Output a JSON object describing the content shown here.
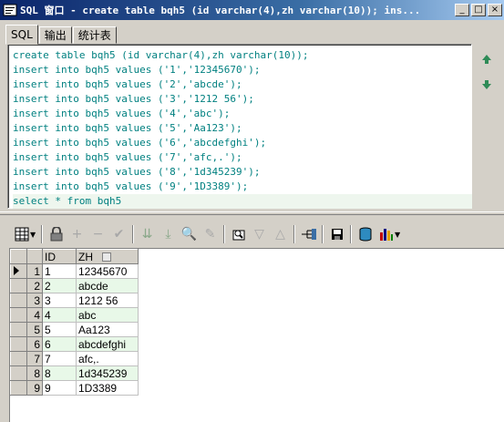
{
  "window": {
    "title": "SQL 窗口 - create table bqh5 (id varchar(4),zh varchar(10)); ins...",
    "buttons": {
      "minimize": "_",
      "maximize": "□",
      "close": "×"
    }
  },
  "tabs": [
    {
      "label": "SQL",
      "active": true
    },
    {
      "label": "输出",
      "active": false
    },
    {
      "label": "统计表",
      "active": false
    }
  ],
  "sql_lines": [
    "create table bqh5 (id varchar(4),zh varchar(10));",
    "insert into bqh5 values ('1','12345670');",
    "insert into bqh5 values ('2','abcde');",
    "insert into bqh5 values ('3','1212 56');",
    "insert into bqh5 values ('4','abc');",
    "insert into bqh5 values ('5','Aa123');",
    "insert into bqh5 values ('6','abcdefghi');",
    "insert into bqh5 values ('7','afc,.');",
    "insert into bqh5 values ('8','1d345239');",
    "insert into bqh5 values ('9','1D3389');",
    "select * from bqh5"
  ],
  "grid": {
    "columns": [
      "ID",
      "ZH"
    ],
    "rows": [
      {
        "num": "1",
        "id": "1",
        "zh": "12345670"
      },
      {
        "num": "2",
        "id": "2",
        "zh": "abcde"
      },
      {
        "num": "3",
        "id": "3",
        "zh": "1212 56"
      },
      {
        "num": "4",
        "id": "4",
        "zh": "abc"
      },
      {
        "num": "5",
        "id": "5",
        "zh": "Aa123"
      },
      {
        "num": "6",
        "id": "6",
        "zh": "abcdefghi"
      },
      {
        "num": "7",
        "id": "7",
        "zh": "afc,."
      },
      {
        "num": "8",
        "id": "8",
        "zh": "1d345239"
      },
      {
        "num": "9",
        "id": "9",
        "zh": "1D3389"
      }
    ],
    "alt_row_color": "#e8f8e8"
  },
  "toolbar_icons": [
    "grid-layout-icon",
    "lock-icon",
    "insert-record-icon",
    "delete-record-icon",
    "post-changes-icon",
    "next-page-icon",
    "last-page-icon",
    "find-icon",
    "clear-icon",
    "query-by-example-icon",
    "filter-icon",
    "sort-icon",
    "link-icon",
    "save-icon",
    "export-icon",
    "chart-icon"
  ],
  "colors": {
    "sql_text": "#008080",
    "titlebar_start": "#0a246a",
    "nav_arrow": "#2e8b57"
  }
}
